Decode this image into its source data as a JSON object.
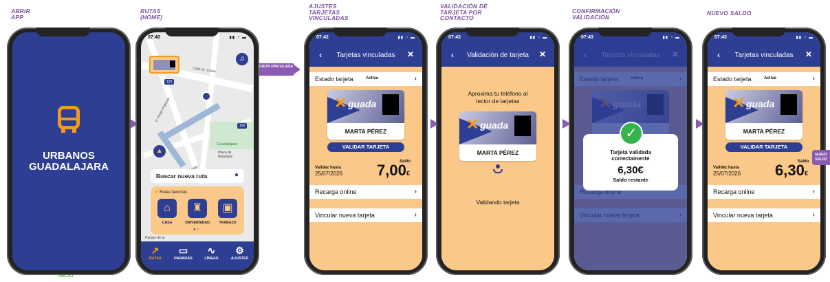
{
  "labels": {
    "s1": "ABRIR APP",
    "s2": "RUTAS (HOME)",
    "s3": "AJUSTES TARJETAS VINCULADAS",
    "s4": "VALIDACIÓN DE TARJETA POR CONTACTO",
    "s5": "CONFIRMACIÓN VALIDACIÓN",
    "s6": "NUEVO SALDO",
    "inicio": "INICIO",
    "tarjeta_vinculada": "TARJETA VINCULADA",
    "nuevo_saldo": "NUEVO SALDO"
  },
  "splash": {
    "line1": "URBANOS",
    "line2": "GUADALAJARA"
  },
  "time": {
    "t1": "07:40",
    "t2": "07:42",
    "t3": "07:43"
  },
  "map": {
    "streets": [
      "Calle Dr. Creus",
      "C. Pedro Pascual",
      "C. Mirasol",
      "Plaza de Bejanque",
      "Guadalajara",
      "Parque de la"
    ],
    "route_numbers": [
      "125",
      "156"
    ],
    "search_placeholder": "Buscar nueva ruta",
    "favorites_title": "Rutas favoritas",
    "favorites": [
      "CASA",
      "UNIVERSIDAD",
      "TRABAJO"
    ],
    "tabs": [
      "RUTAS",
      "PARADAS",
      "LÍNEAS",
      "AJUSTES"
    ]
  },
  "cards_screen": {
    "title": "Tarjetas vinculadas",
    "estado_label": "Estado tarjeta",
    "estado_value": "Activa",
    "card_brand": "guada",
    "card_name": "MARTA PÉREZ",
    "validate_button": "VALIDAR TARJETA",
    "validez_label": "Validez hasta",
    "validez_date": "25/07/2026",
    "saldo_label": "Saldo",
    "saldo_before": "7,00",
    "saldo_after": "6,30",
    "currency": "€",
    "recarga": "Recarga online",
    "vincular": "Vincular nueva tarjeta"
  },
  "validation_screen": {
    "title": "Validación de tarjeta",
    "instruction": "Aproxima tu teléfono al lector de tarjetas",
    "status": "Validando tarjeta"
  },
  "confirm_popup": {
    "title": "Tarjeta validada correctamente",
    "amount": "6,30€",
    "sub": "Saldo restante"
  },
  "colors": {
    "navy": "#2d3e93",
    "orange": "#fac98a",
    "purple": "#8a5bb1",
    "green": "#34b44a"
  }
}
